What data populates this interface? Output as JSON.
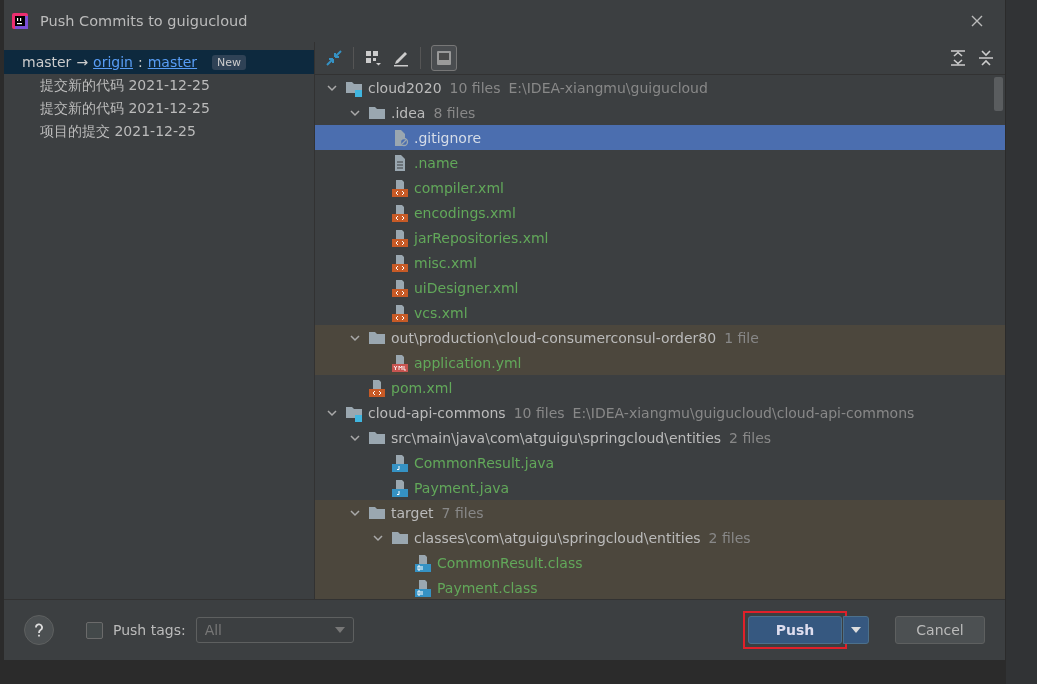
{
  "window": {
    "title": "Push Commits to guigucloud"
  },
  "branch": {
    "local": "master",
    "arrow": "→",
    "remote": "origin",
    "separator": ":",
    "remote_branch": "master",
    "badge": "New",
    "selected": true
  },
  "commits": [
    {
      "label": "提交新的代码 2021-12-25"
    },
    {
      "label": "提交新的代码 2021-12-25"
    },
    {
      "label": "项目的提交 2021-12-25"
    }
  ],
  "tree": [
    {
      "kind": "module",
      "name": "cloud2020",
      "count": "10 files",
      "path": "E:\\IDEA-xiangmu\\guigucloud",
      "expanded": true,
      "children": [
        {
          "kind": "folder",
          "name": ".idea",
          "count": "8 files",
          "expanded": true,
          "excluded": false,
          "children": [
            {
              "kind": "ignored",
              "name": ".gitignore",
              "selected": true
            },
            {
              "kind": "text",
              "name": ".name",
              "selected": false
            },
            {
              "kind": "xml",
              "name": "compiler.xml",
              "selected": false
            },
            {
              "kind": "xml",
              "name": "encodings.xml",
              "selected": false
            },
            {
              "kind": "xml",
              "name": "jarRepositories.xml",
              "selected": false
            },
            {
              "kind": "xml",
              "name": "misc.xml",
              "selected": false
            },
            {
              "kind": "xml",
              "name": "uiDesigner.xml",
              "selected": false
            },
            {
              "kind": "xml",
              "name": "vcs.xml",
              "selected": false
            }
          ]
        },
        {
          "kind": "folder",
          "name": "out\\production\\cloud-consumerconsul-order80",
          "count": "1 file",
          "expanded": true,
          "excluded": true,
          "children": [
            {
              "kind": "yml",
              "name": "application.yml",
              "selected": false
            }
          ]
        },
        {
          "kind": "xml",
          "name": "pom.xml",
          "selected": false
        }
      ]
    },
    {
      "kind": "module",
      "name": "cloud-api-commons",
      "count": "10 files",
      "path": "E:\\IDEA-xiangmu\\guigucloud\\cloud-api-commons",
      "expanded": true,
      "children": [
        {
          "kind": "folder",
          "name": "src\\main\\java\\com\\atguigu\\springcloud\\entities",
          "count": "2 files",
          "expanded": true,
          "excluded": false,
          "children": [
            {
              "kind": "java",
              "name": "CommonResult.java",
              "selected": false
            },
            {
              "kind": "java",
              "name": "Payment.java",
              "selected": false
            }
          ]
        },
        {
          "kind": "folder",
          "name": "target",
          "count": "7 files",
          "expanded": true,
          "excluded": true,
          "children": [
            {
              "kind": "folder",
              "name": "classes\\com\\atguigu\\springcloud\\entities",
              "count": "2 files",
              "expanded": true,
              "excluded": true,
              "children": [
                {
                  "kind": "class",
                  "name": "CommonResult.class",
                  "selected": false
                },
                {
                  "kind": "class",
                  "name": "Payment.class",
                  "selected": false
                }
              ]
            }
          ]
        }
      ]
    }
  ],
  "footer": {
    "push_tags": {
      "label": "Push tags:",
      "checked": false
    },
    "tags_dropdown": {
      "value": "All",
      "disabled": true
    },
    "push_button": "Push",
    "cancel_button": "Cancel",
    "push_highlighted": true
  }
}
